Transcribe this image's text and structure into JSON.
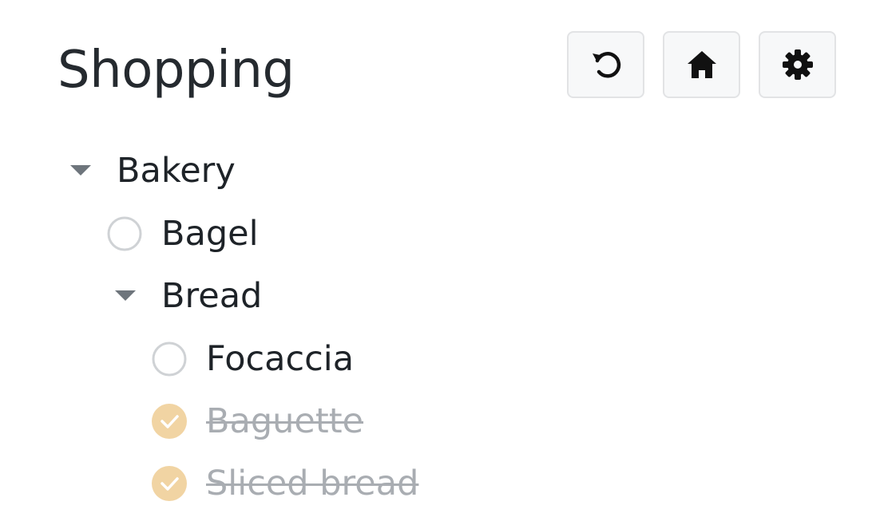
{
  "header": {
    "title": "Shopping"
  },
  "toolbar": {
    "buttons": [
      {
        "icon": "undo-icon"
      },
      {
        "icon": "home-icon"
      },
      {
        "icon": "gear-icon"
      }
    ]
  },
  "tree": {
    "bakery": {
      "label": "Bakery",
      "expanded": true
    },
    "bagel": {
      "label": "Bagel",
      "checked": false
    },
    "bread": {
      "label": "Bread",
      "expanded": true
    },
    "focaccia": {
      "label": "Focaccia",
      "checked": false
    },
    "baguette": {
      "label": "Baguette",
      "checked": true
    },
    "sliced_bread": {
      "label": "Sliced bread",
      "checked": true
    }
  },
  "colors": {
    "text": "#1e2328",
    "done_text": "#a9adb2",
    "check_fill": "#f1d4a3",
    "caret": "#6e757c",
    "circle_border": "#cfd2d5",
    "button_bg": "#f7f8f9",
    "button_border": "#e2e3e5"
  }
}
